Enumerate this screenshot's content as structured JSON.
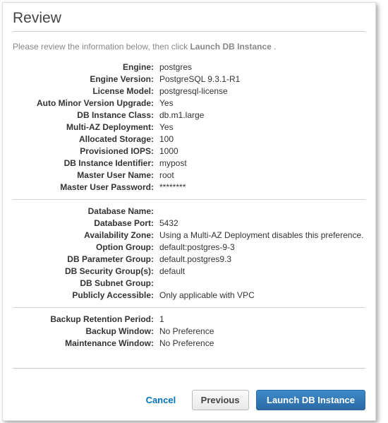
{
  "title": "Review",
  "intro_prefix": "Please review the information below, then click ",
  "intro_bold": "Launch DB Instance",
  "intro_suffix": " .",
  "section1": [
    {
      "label": "Engine:",
      "value": "postgres"
    },
    {
      "label": "Engine Version:",
      "value": "PostgreSQL 9.3.1-R1"
    },
    {
      "label": "License Model:",
      "value": "postgresql-license"
    },
    {
      "label": "Auto Minor Version Upgrade:",
      "value": "Yes"
    },
    {
      "label": "DB Instance Class:",
      "value": "db.m1.large"
    },
    {
      "label": "Multi-AZ Deployment:",
      "value": "Yes"
    },
    {
      "label": "Allocated Storage:",
      "value": "100"
    },
    {
      "label": "Provisioned IOPS:",
      "value": "1000"
    },
    {
      "label": "DB Instance Identifier:",
      "value": "mypost"
    },
    {
      "label": "Master User Name:",
      "value": "root"
    },
    {
      "label": "Master User Password:",
      "value": "********"
    }
  ],
  "section2": [
    {
      "label": "Database Name:",
      "value": ""
    },
    {
      "label": "Database Port:",
      "value": "5432"
    },
    {
      "label": "Availability Zone:",
      "value": "Using a Multi-AZ Deployment disables this preference."
    },
    {
      "label": "Option Group:",
      "value": "default:postgres-9-3"
    },
    {
      "label": "DB Parameter Group:",
      "value": "default.postgres9.3"
    },
    {
      "label": "DB Security Group(s):",
      "value": "default"
    },
    {
      "label": "DB Subnet Group:",
      "value": ""
    },
    {
      "label": "Publicly Accessible:",
      "value": "Only applicable with VPC"
    }
  ],
  "section3": [
    {
      "label": "Backup Retention Period:",
      "value": "1"
    },
    {
      "label": "Backup Window:",
      "value": "No Preference"
    },
    {
      "label": "Maintenance Window:",
      "value": "No Preference"
    }
  ],
  "buttons": {
    "cancel": "Cancel",
    "previous": "Previous",
    "launch": "Launch DB Instance"
  }
}
